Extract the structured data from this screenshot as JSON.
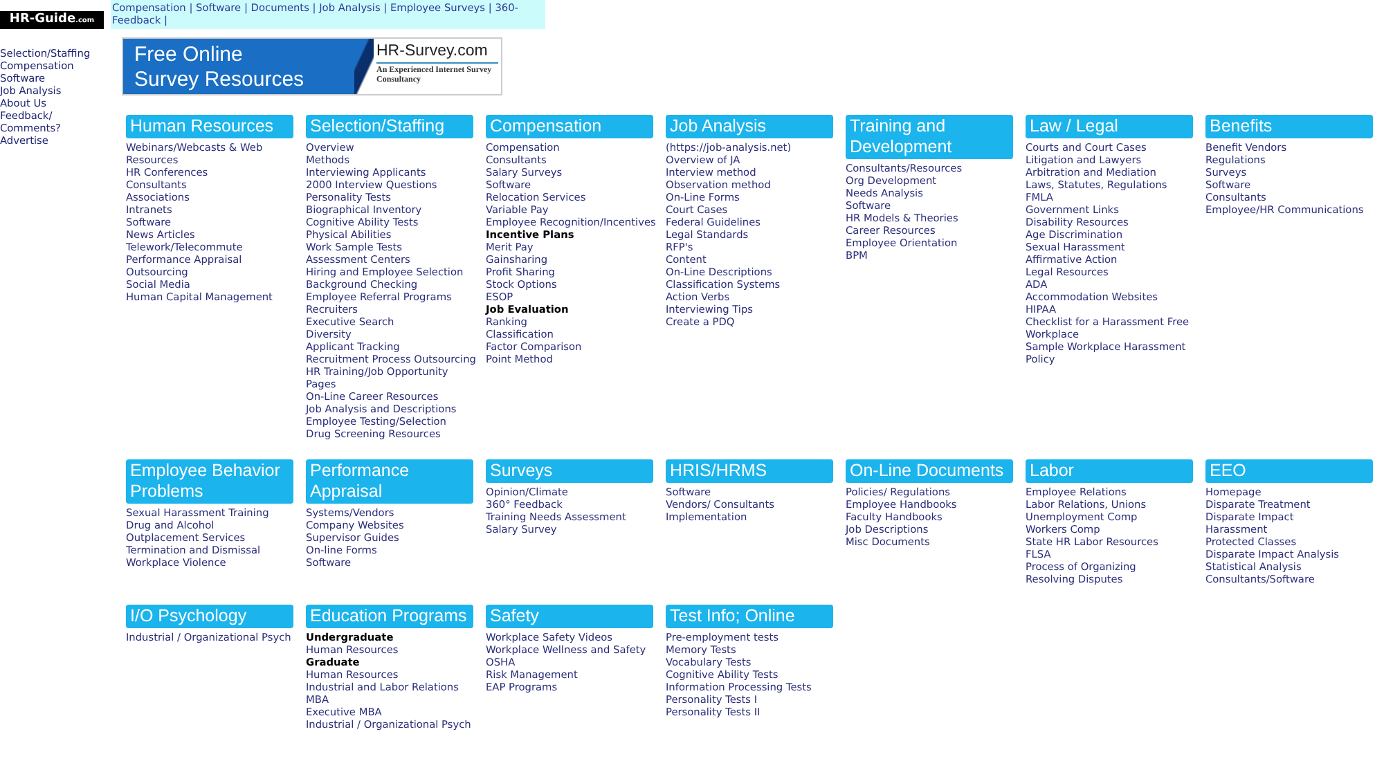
{
  "logo": {
    "name": "HR-Guide",
    "suffix": ".com"
  },
  "top_nav": {
    "text": "Compensation | Software | Documents | Job Analysis | Employee Surveys | 360-Feedback |"
  },
  "sidebar": {
    "items": [
      "Selection/Staffing",
      "Compensation",
      "Software",
      "Job Analysis",
      "About Us",
      "Feedback/ Comments?",
      "Advertise"
    ]
  },
  "banner": {
    "title_lines": [
      "Free Online",
      "Survey Resources"
    ],
    "brand": "HR-Survey.com",
    "tagline": "An Experienced Internet Survey Consultancy"
  },
  "section_rows": [
    [
      {
        "title": "Human Resources",
        "items": [
          {
            "kind": "link",
            "text": "Webinars/Webcasts & Web Resources"
          },
          {
            "kind": "link",
            "text": "HR Conferences"
          },
          {
            "kind": "link",
            "text": "Consultants"
          },
          {
            "kind": "link",
            "text": "Associations"
          },
          {
            "kind": "link",
            "text": "Intranets"
          },
          {
            "kind": "link",
            "text": "Software"
          },
          {
            "kind": "link",
            "text": "News Articles"
          },
          {
            "kind": "link",
            "text": "Telework/Telecommute"
          },
          {
            "kind": "link",
            "text": "Performance Appraisal"
          },
          {
            "kind": "link",
            "text": "Outsourcing"
          },
          {
            "kind": "link",
            "text": "Social Media"
          },
          {
            "kind": "link",
            "text": "Human Capital Management"
          }
        ]
      },
      {
        "title": "Selection/Staffing",
        "items": [
          {
            "kind": "link",
            "text": "Overview"
          },
          {
            "kind": "link",
            "text": "Methods"
          },
          {
            "kind": "link",
            "text": "Interviewing Applicants"
          },
          {
            "kind": "link",
            "text": "2000 Interview Questions"
          },
          {
            "kind": "link",
            "text": "Personality Tests"
          },
          {
            "kind": "link",
            "text": "Biographical Inventory"
          },
          {
            "kind": "link",
            "text": "Cognitive Ability Tests"
          },
          {
            "kind": "link",
            "text": "Physical Abilities"
          },
          {
            "kind": "link",
            "text": "Work Sample Tests"
          },
          {
            "kind": "link",
            "text": "Assessment Centers"
          },
          {
            "kind": "link",
            "text": "Hiring and Employee Selection"
          },
          {
            "kind": "link",
            "text": "Background Checking"
          },
          {
            "kind": "link",
            "text": "Employee Referral Programs"
          },
          {
            "kind": "link",
            "text": "Recruiters"
          },
          {
            "kind": "link",
            "text": "Executive Search"
          },
          {
            "kind": "link",
            "text": "Diversity"
          },
          {
            "kind": "link",
            "text": "Applicant Tracking"
          },
          {
            "kind": "link",
            "text": "Recruitment Process Outsourcing"
          },
          {
            "kind": "link",
            "text": "HR Training/Job Opportunity Pages"
          },
          {
            "kind": "link",
            "text": "On-Line Career Resources"
          },
          {
            "kind": "link",
            "text": "Job Analysis and Descriptions"
          },
          {
            "kind": "link",
            "text": "Employee Testing/Selection"
          },
          {
            "kind": "link",
            "text": "Drug Screening Resources"
          }
        ]
      },
      {
        "title": "Compensation",
        "items": [
          {
            "kind": "link",
            "text": "Compensation"
          },
          {
            "kind": "link",
            "text": "Consultants"
          },
          {
            "kind": "link",
            "text": "Salary Surveys"
          },
          {
            "kind": "link",
            "text": "Software"
          },
          {
            "kind": "link",
            "text": "Relocation Services"
          },
          {
            "kind": "link",
            "text": "Variable Pay"
          },
          {
            "kind": "link",
            "text": "Employee Recognition/Incentives"
          },
          {
            "kind": "heading",
            "text": "Incentive Plans"
          },
          {
            "kind": "link",
            "text": "Merit Pay"
          },
          {
            "kind": "link",
            "text": "Gainsharing"
          },
          {
            "kind": "link",
            "text": "Profit Sharing"
          },
          {
            "kind": "link",
            "text": "Stock Options"
          },
          {
            "kind": "link",
            "text": "ESOP"
          },
          {
            "kind": "heading",
            "text": "Job Evaluation"
          },
          {
            "kind": "link",
            "text": "Ranking"
          },
          {
            "kind": "link",
            "text": "Classification"
          },
          {
            "kind": "link",
            "text": "Factor Comparison"
          },
          {
            "kind": "link",
            "text": "Point Method"
          }
        ]
      },
      {
        "title": "Job Analysis",
        "items": [
          {
            "kind": "link",
            "text": "(https://job-analysis.net)"
          },
          {
            "kind": "link",
            "text": "Overview of JA"
          },
          {
            "kind": "link",
            "text": "Interview method"
          },
          {
            "kind": "link",
            "text": "Observation method"
          },
          {
            "kind": "link",
            "text": "On-Line Forms"
          },
          {
            "kind": "link",
            "text": "Court Cases"
          },
          {
            "kind": "link",
            "text": "Federal Guidelines"
          },
          {
            "kind": "link",
            "text": "Legal Standards"
          },
          {
            "kind": "link",
            "text": "RFP's"
          },
          {
            "kind": "link",
            "text": "Content"
          },
          {
            "kind": "link",
            "text": "On-Line Descriptions"
          },
          {
            "kind": "link",
            "text": "Classification Systems"
          },
          {
            "kind": "link",
            "text": "Action Verbs"
          },
          {
            "kind": "link",
            "text": "Interviewing Tips"
          },
          {
            "kind": "link",
            "text": "Create a PDQ"
          }
        ]
      },
      {
        "title": "Training and Development",
        "items": [
          {
            "kind": "link",
            "text": "Consultants/Resources"
          },
          {
            "kind": "link",
            "text": "Org Development"
          },
          {
            "kind": "link",
            "text": "Needs Analysis"
          },
          {
            "kind": "link",
            "text": "Software"
          },
          {
            "kind": "link",
            "text": "HR Models & Theories"
          },
          {
            "kind": "link",
            "text": "Career Resources"
          },
          {
            "kind": "link",
            "text": "Employee Orientation"
          },
          {
            "kind": "link",
            "text": "BPM"
          }
        ]
      },
      {
        "title": "Law / Legal",
        "items": [
          {
            "kind": "link",
            "text": "Courts and Court Cases"
          },
          {
            "kind": "link",
            "text": "Litigation and Lawyers"
          },
          {
            "kind": "link",
            "text": "Arbitration and Mediation"
          },
          {
            "kind": "link",
            "text": "Laws, Statutes, Regulations"
          },
          {
            "kind": "link",
            "text": "FMLA"
          },
          {
            "kind": "link",
            "text": "Government Links"
          },
          {
            "kind": "link",
            "text": "Disability Resources"
          },
          {
            "kind": "link",
            "text": "Age Discrimination"
          },
          {
            "kind": "link",
            "text": "Sexual Harassment"
          },
          {
            "kind": "link",
            "text": "Affirmative Action"
          },
          {
            "kind": "link",
            "text": "Legal Resources"
          },
          {
            "kind": "link",
            "text": "ADA"
          },
          {
            "kind": "link",
            "text": "Accommodation Websites"
          },
          {
            "kind": "link",
            "text": "HIPAA"
          },
          {
            "kind": "link",
            "text": "Checklist for a Harassment Free Workplace"
          },
          {
            "kind": "link",
            "text": "Sample Workplace Harassment Policy"
          }
        ]
      },
      {
        "title": "Benefits",
        "items": [
          {
            "kind": "link",
            "text": "Benefit Vendors"
          },
          {
            "kind": "link",
            "text": "Regulations"
          },
          {
            "kind": "link",
            "text": "Surveys"
          },
          {
            "kind": "link",
            "text": "Software"
          },
          {
            "kind": "link",
            "text": "Consultants"
          },
          {
            "kind": "link",
            "text": "Employee/HR Communications"
          }
        ]
      }
    ],
    [
      {
        "title": "Employee Behavior Problems",
        "items": [
          {
            "kind": "link",
            "text": "Sexual Harassment Training"
          },
          {
            "kind": "link",
            "text": "Drug and Alcohol"
          },
          {
            "kind": "link",
            "text": "Outplacement Services"
          },
          {
            "kind": "link",
            "text": "Termination and Dismissal"
          },
          {
            "kind": "link",
            "text": "Workplace Violence"
          }
        ]
      },
      {
        "title": "Performance Appraisal",
        "items": [
          {
            "kind": "link",
            "text": "Systems/Vendors"
          },
          {
            "kind": "link",
            "text": "Company Websites"
          },
          {
            "kind": "link",
            "text": "Supervisor Guides"
          },
          {
            "kind": "link",
            "text": "On-line Forms"
          },
          {
            "kind": "link",
            "text": "Software"
          }
        ]
      },
      {
        "title": "Surveys",
        "items": [
          {
            "kind": "link",
            "text": "Opinion/Climate"
          },
          {
            "kind": "link",
            "text": "360° Feedback"
          },
          {
            "kind": "link",
            "text": "Training Needs Assessment"
          },
          {
            "kind": "link",
            "text": "Salary Survey"
          }
        ]
      },
      {
        "title": "HRIS/HRMS",
        "items": [
          {
            "kind": "link",
            "text": "Software"
          },
          {
            "kind": "link",
            "text": "Vendors/ Consultants"
          },
          {
            "kind": "link",
            "text": "Implementation"
          }
        ]
      },
      {
        "title": "On-Line Documents",
        "items": [
          {
            "kind": "link",
            "text": "Policies/ Regulations"
          },
          {
            "kind": "link",
            "text": "Employee Handbooks"
          },
          {
            "kind": "link",
            "text": "Faculty Handbooks"
          },
          {
            "kind": "link",
            "text": "Job Descriptions"
          },
          {
            "kind": "link",
            "text": "Misc Documents"
          }
        ]
      },
      {
        "title": "Labor",
        "items": [
          {
            "kind": "link",
            "text": "Employee Relations"
          },
          {
            "kind": "link",
            "text": "Labor Relations, Unions"
          },
          {
            "kind": "link",
            "text": "Unemployment Comp"
          },
          {
            "kind": "link",
            "text": "Workers Comp"
          },
          {
            "kind": "link",
            "text": "State HR Labor Resources"
          },
          {
            "kind": "link",
            "text": "FLSA"
          },
          {
            "kind": "link",
            "text": "Process of Organizing"
          },
          {
            "kind": "link",
            "text": "Resolving Disputes"
          }
        ]
      },
      {
        "title": "EEO",
        "items": [
          {
            "kind": "link",
            "text": "Homepage"
          },
          {
            "kind": "link",
            "text": "Disparate Treatment"
          },
          {
            "kind": "link",
            "text": "Disparate Impact"
          },
          {
            "kind": "link",
            "text": "Harassment"
          },
          {
            "kind": "link",
            "text": "Protected Classes"
          },
          {
            "kind": "link",
            "text": "Disparate Impact Analysis"
          },
          {
            "kind": "link",
            "text": "Statistical Analysis"
          },
          {
            "kind": "link",
            "text": "Consultants/Software"
          }
        ]
      }
    ],
    [
      {
        "title": "I/O Psychology",
        "items": [
          {
            "kind": "link",
            "text": "Industrial / Organizational Psych"
          }
        ]
      },
      {
        "title": "Education Programs",
        "items": [
          {
            "kind": "heading",
            "text": "Undergraduate"
          },
          {
            "kind": "link",
            "text": "Human Resources"
          },
          {
            "kind": "heading",
            "text": "Graduate"
          },
          {
            "kind": "link",
            "text": "Human Resources"
          },
          {
            "kind": "link",
            "text": "Industrial and Labor Relations"
          },
          {
            "kind": "link",
            "text": "MBA"
          },
          {
            "kind": "link",
            "text": "Executive MBA"
          },
          {
            "kind": "link",
            "text": "Industrial / Organizational Psych"
          }
        ]
      },
      {
        "title": "Safety",
        "items": [
          {
            "kind": "link",
            "text": "Workplace Safety Videos"
          },
          {
            "kind": "link",
            "text": "Workplace Wellness and Safety"
          },
          {
            "kind": "link",
            "text": "OSHA"
          },
          {
            "kind": "link",
            "text": "Risk Management"
          },
          {
            "kind": "link",
            "text": "EAP Programs"
          }
        ]
      },
      {
        "title": "Test Info; Online",
        "items": [
          {
            "kind": "link",
            "text": "Pre-employment tests"
          },
          {
            "kind": "link",
            "text": "Memory Tests"
          },
          {
            "kind": "link",
            "text": "Vocabulary Tests"
          },
          {
            "kind": "link",
            "text": "Cognitive Ability Tests"
          },
          {
            "kind": "link",
            "text": "Information Processing Tests"
          },
          {
            "kind": "link",
            "text": "Personality Tests I"
          },
          {
            "kind": "link",
            "text": "Personality Tests II"
          }
        ]
      }
    ]
  ]
}
